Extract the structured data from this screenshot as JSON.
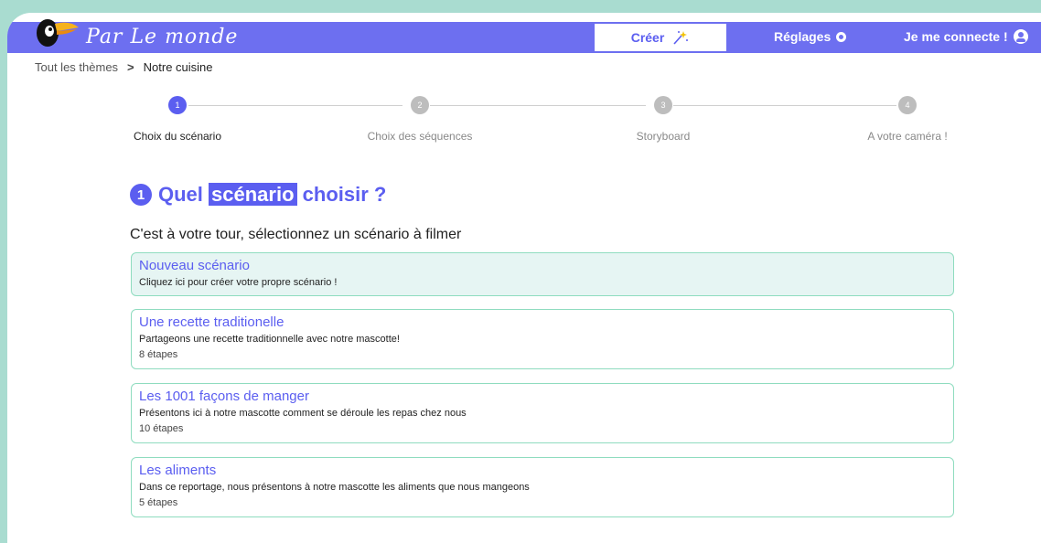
{
  "header": {
    "brand": "Par Le monde",
    "create_label": "Créer",
    "settings_label": "Réglages",
    "login_label": "Je me connecte !",
    "accent": "#6d6ff0"
  },
  "breadcrumb": {
    "root": "Tout les thèmes",
    "separator": ">",
    "current": "Notre cuisine"
  },
  "stepper": [
    {
      "number": "1",
      "label": "Choix du scénario",
      "active": true
    },
    {
      "number": "2",
      "label": "Choix des séquences",
      "active": false
    },
    {
      "number": "3",
      "label": "Storyboard",
      "active": false
    },
    {
      "number": "4",
      "label": "A votre caméra !",
      "active": false
    }
  ],
  "main": {
    "step_number": "1",
    "title_before": "Quel",
    "title_highlight": "scénario",
    "title_after": "choisir ?",
    "instruction": "C'est à votre tour, sélectionnez un scénario à filmer"
  },
  "scenarios": [
    {
      "title": "Nouveau scénario",
      "description": "Cliquez ici pour créer votre propre scénario !",
      "steps": ""
    },
    {
      "title": "Une recette traditionelle",
      "description": "Partageons une recette traditionnelle avec notre mascotte!",
      "steps": "8 étapes"
    },
    {
      "title": "Les 1001 façons de manger",
      "description": "Présentons ici à notre mascotte comment se déroule les repas chez nous",
      "steps": "10 étapes"
    },
    {
      "title": "Les aliments",
      "description": "Dans ce reportage, nous présentons à notre mascotte les aliments que nous mangeons",
      "steps": "5 étapes"
    }
  ],
  "icons": {
    "logo": "toucan-logo-icon",
    "create": "magic-wand-icon",
    "settings": "gear-icon",
    "login": "user-circle-icon"
  }
}
